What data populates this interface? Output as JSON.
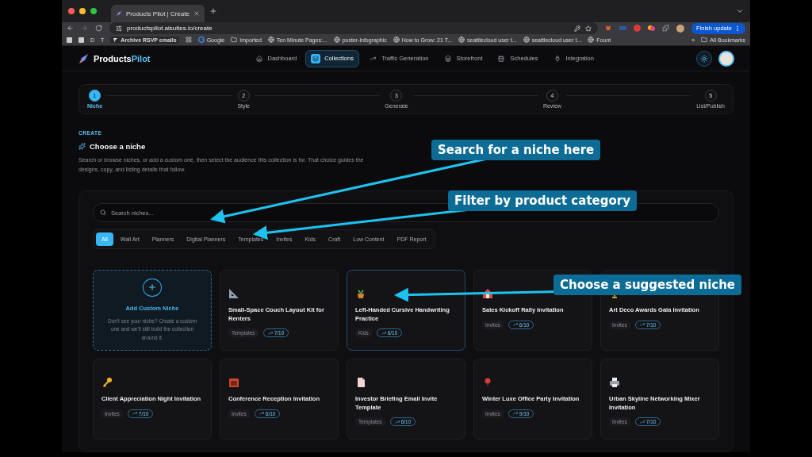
{
  "browser": {
    "tab_title": "Products Pilot | Create",
    "url": "productspilot.aisuites.io/create",
    "update_button": "Finish update",
    "bookmarks": [
      {
        "kind": "letter",
        "label": "D"
      },
      {
        "kind": "letter",
        "label": "T"
      },
      {
        "kind": "bold",
        "label": "Archive RSVP emails"
      },
      {
        "kind": "google",
        "label": "Google"
      },
      {
        "kind": "folder",
        "label": "Imported"
      },
      {
        "kind": "globe",
        "label": "Ten Minute Pages:..."
      },
      {
        "kind": "globe",
        "label": "poster-infographic"
      },
      {
        "kind": "globe",
        "label": "How to Grow: 21 T..."
      },
      {
        "kind": "globe",
        "label": "seattlecloud user t..."
      },
      {
        "kind": "globe",
        "label": "seattlecloud user t..."
      },
      {
        "kind": "globe",
        "label": "Fount"
      }
    ],
    "more_bookmarks": "»",
    "all_bookmarks": "All Bookmarks"
  },
  "app": {
    "brand": {
      "first": "Products",
      "second": "Pilot"
    },
    "nav": [
      {
        "label": "Dashboard",
        "selected": false
      },
      {
        "label": "Collections",
        "selected": true
      },
      {
        "label": "Traffic Generation",
        "selected": false
      },
      {
        "label": "Storefront",
        "selected": false
      },
      {
        "label": "Schedules",
        "selected": false
      },
      {
        "label": "Integration",
        "selected": false
      }
    ],
    "steps": [
      {
        "number": "1",
        "label": "Niche",
        "selected": true
      },
      {
        "number": "2",
        "label": "Style",
        "selected": false
      },
      {
        "number": "3",
        "label": "Generate",
        "selected": false
      },
      {
        "number": "4",
        "label": "Review",
        "selected": false
      },
      {
        "number": "5",
        "label": "List/Publish",
        "selected": false
      }
    ],
    "eyebrow": "CREATE",
    "heading": "Choose a niche",
    "description": "Search or browse niches, or add a custom one, then select the audience this collection is for. That choice guides the designs, copy, and listing details that follow.",
    "search": {
      "placeholder": "Search niches..."
    },
    "filters": [
      {
        "label": "All",
        "selected": true
      },
      {
        "label": "Wall Art",
        "selected": false
      },
      {
        "label": "Planners",
        "selected": false
      },
      {
        "label": "Digital Planners",
        "selected": false
      },
      {
        "label": "Templates",
        "selected": false
      },
      {
        "label": "Invites",
        "selected": false
      },
      {
        "label": "Kids",
        "selected": false
      },
      {
        "label": "Craft",
        "selected": false
      },
      {
        "label": "Low Content",
        "selected": false
      },
      {
        "label": "PDF Report",
        "selected": false
      }
    ],
    "custom_card": {
      "title": "Add Custom Niche",
      "text": "Don't see your niche? Create a custom one and we'll still build the collection around it."
    },
    "cards": [
      {
        "title": "Small-Space Couch Layout Kit for Renters",
        "category": "Templates",
        "score": "7/10",
        "selected": false
      },
      {
        "title": "Left-Handed Cursive Handwriting Practice",
        "category": "Kids",
        "score": "6/10",
        "selected": true
      },
      {
        "title": "Sales Kickoff Rally Invitation",
        "category": "Invites",
        "score": "6/10",
        "selected": false
      },
      {
        "title": "Art Deco Awards Gala Invitation",
        "category": "Invites",
        "score": "7/10",
        "selected": false
      },
      {
        "title": "Client Appreciation Night Invitation",
        "category": "Invites",
        "score": "7/10",
        "selected": false
      },
      {
        "title": "Conference Reception Invitation",
        "category": "Invites",
        "score": "6/10",
        "selected": false
      },
      {
        "title": "Investor Briefing Email Invite Template",
        "category": "Templates",
        "score": "6/10",
        "selected": false
      },
      {
        "title": "Winter Luxe Office Party Invitation",
        "category": "Invites",
        "score": "9/10",
        "selected": false
      },
      {
        "title": "Urban Skyline Networking Mixer Invitation",
        "category": "Invites",
        "score": "7/10",
        "selected": false
      }
    ]
  },
  "annotations": [
    {
      "text": "Search for a niche here"
    },
    {
      "text": "Filter by product category"
    },
    {
      "text": "Choose a suggested niche"
    }
  ]
}
